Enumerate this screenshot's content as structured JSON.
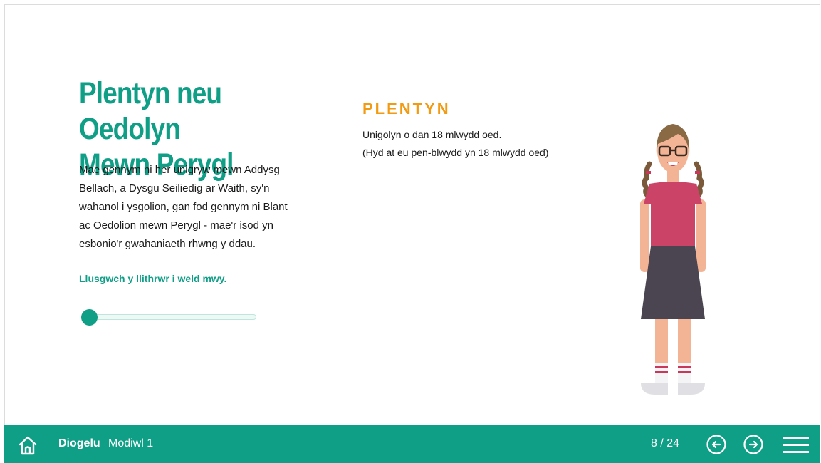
{
  "main": {
    "title_line1": "Plentyn neu Oedolyn",
    "title_line2": "Mewn Perygl",
    "intro_lines": [
      "Mae gennym ni her unigryw mewn Addysg",
      "Bellach, a Dysgu Seiliedig ar Waith, sy'n",
      "wahanol i ysgolion, gan fod gennym ni Blant",
      "ac Oedolion mewn Perygl - mae'r isod yn",
      "esbonio'r gwahaniaeth rhwng y ddau."
    ],
    "drag_hint": "Llusgwch y llithrwr i weld mwy.",
    "slider_value": 0
  },
  "panel": {
    "term": "PLENTYN",
    "definition_line1": "Unigolyn o dan 18 mlwydd oed.",
    "definition_line2": "(Hyd at eu pen-blwydd yn 18 mlwydd oed)",
    "figure_icon": "girl-illustration-icon"
  },
  "footer": {
    "home_icon": "home-icon",
    "course": "Diogelu",
    "module": "Modiwl 1",
    "page": "8 / 24",
    "prev_icon": "arrow-left-circle-icon",
    "next_icon": "arrow-right-circle-icon",
    "menu_icon": "hamburger-menu-icon"
  },
  "colors": {
    "brand": "#0f9e86",
    "accent": "#f29a12"
  }
}
